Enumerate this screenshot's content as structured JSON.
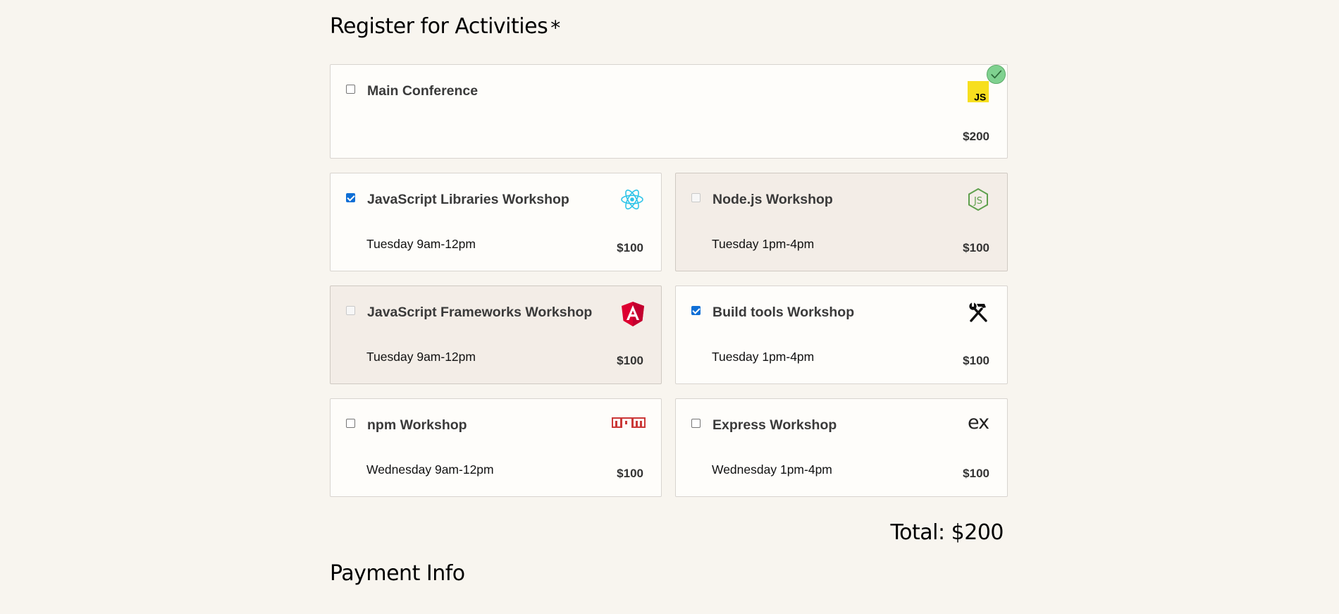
{
  "activities": {
    "heading": "Register for Activities",
    "required_marker": "*",
    "valid_icon": "check-circle-icon",
    "items": [
      {
        "title": "Main Conference",
        "when": "",
        "price": "$200",
        "checked": false,
        "disabled": false,
        "icon": "javascript-logo-icon"
      },
      {
        "title": "JavaScript Libraries Workshop",
        "when": "Tuesday 9am-12pm",
        "price": "$100",
        "checked": true,
        "disabled": false,
        "icon": "react-logo-icon"
      },
      {
        "title": "Node.js Workshop",
        "when": "Tuesday 1pm-4pm",
        "price": "$100",
        "checked": false,
        "disabled": true,
        "icon": "nodejs-logo-icon"
      },
      {
        "title": "JavaScript Frameworks Workshop",
        "when": "Tuesday 9am-12pm",
        "price": "$100",
        "checked": false,
        "disabled": true,
        "icon": "angular-logo-icon"
      },
      {
        "title": "Build tools Workshop",
        "when": "Tuesday 1pm-4pm",
        "price": "$100",
        "checked": true,
        "disabled": false,
        "icon": "hammer-wrench-icon"
      },
      {
        "title": "npm Workshop",
        "when": "Wednesday 9am-12pm",
        "price": "$100",
        "checked": false,
        "disabled": false,
        "icon": "npm-logo-icon"
      },
      {
        "title": "Express Workshop",
        "when": "Wednesday 1pm-4pm",
        "price": "$100",
        "checked": false,
        "disabled": false,
        "icon": "express-logo-icon"
      }
    ],
    "total": "Total: $200"
  },
  "payment": {
    "heading": "Payment Info"
  },
  "colors": {
    "page_bg": "#f8f5ef",
    "card_bg": "#fefdfa",
    "disabled_bg": "#f3ede7",
    "checkbox_checked": "#0f6fd6",
    "valid_green": "#7fd18f"
  }
}
